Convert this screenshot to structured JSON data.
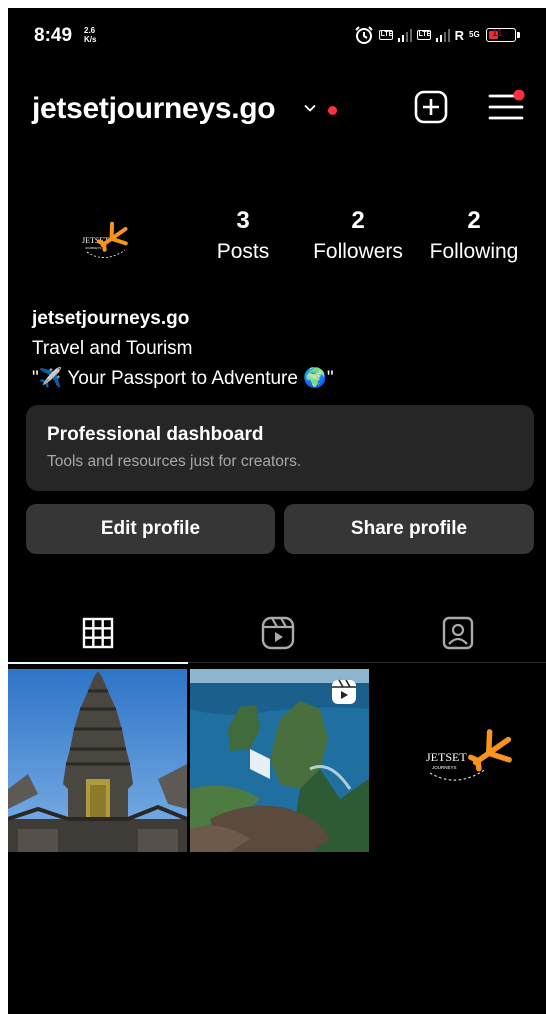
{
  "status_bar": {
    "time": "8:49",
    "speed_value": "2.6",
    "speed_unit": "K/s",
    "lte1": "LTE",
    "lte2": "LTE",
    "roaming": "R",
    "network": "5G",
    "battery": "11"
  },
  "header": {
    "username": "jetsetjourneys.go"
  },
  "profile": {
    "logo_text": "JETSET",
    "logo_subtext": "JOURNEYS",
    "stats": [
      {
        "value": "3",
        "label": "Posts"
      },
      {
        "value": "2",
        "label": "Followers"
      },
      {
        "value": "2",
        "label": "Following"
      }
    ],
    "name": "jetsetjourneys.go",
    "category": "Travel and Tourism",
    "bio": "\"✈️ Your Passport to Adventure 🌍\""
  },
  "dashboard": {
    "title": "Professional dashboard",
    "subtitle": "Tools and resources just for creators."
  },
  "buttons": {
    "edit": "Edit profile",
    "share": "Share profile"
  },
  "tabs": [
    {
      "icon": "grid-icon",
      "active": true
    },
    {
      "icon": "reels-icon",
      "active": false
    },
    {
      "icon": "tagged-icon",
      "active": false
    }
  ],
  "posts": [
    {
      "kind": "photo",
      "subject": "temple"
    },
    {
      "kind": "reel",
      "subject": "coastal-cliff"
    },
    {
      "kind": "photo",
      "subject": "logo",
      "logo_text": "JETSET",
      "logo_subtext": "JOURNEYS"
    }
  ],
  "colors": {
    "background": "#000000",
    "card": "#262626",
    "button": "#363636",
    "secondary_text": "#a8a8a8",
    "notification": "#ff3040",
    "logo_orange": "#f7941d"
  }
}
